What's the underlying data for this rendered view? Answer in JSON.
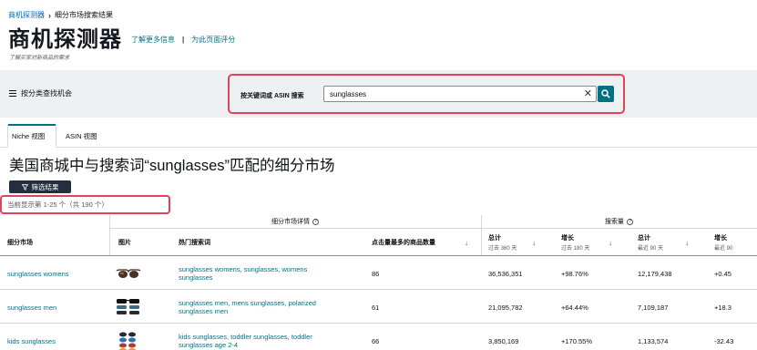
{
  "breadcrumb": {
    "root": "商机探测器",
    "current": "细分市场搜索结果"
  },
  "header": {
    "title": "商机探测器",
    "learn_more": "了解更多信息",
    "rate_page": "为此页面评分",
    "subtitle": "了解买家对新商品的需求"
  },
  "search_band": {
    "category_button": "按分类查找机会",
    "label": "按关键词或 ASIN 搜索",
    "value": "sunglasses",
    "placeholder": ""
  },
  "tabs": [
    {
      "label": "Niche 视图",
      "active": true
    },
    {
      "label": "ASIN 视图",
      "active": false
    }
  ],
  "results": {
    "heading": "美国商城中与搜索词“sunglasses”匹配的细分市场",
    "filter_button": "筛选结果",
    "count_text": "当前显示第 1-25 个（共 190 个）"
  },
  "table": {
    "group_details": "细分市场详情",
    "group_search_volume": "搜索量",
    "columns": {
      "niche": "细分市场",
      "image": "图片",
      "keywords": "热门搜索词",
      "clicked_products": "点击量最多的商品数量",
      "total_360": "总计",
      "total_360_sub": "过去 360 天",
      "growth_180": "增长",
      "growth_180_sub": "过去 180 天",
      "total_90": "总计",
      "total_90_sub": "最近 90 天",
      "growth_90": "增长",
      "growth_90_sub": "最近 90"
    },
    "rows": [
      {
        "niche": "sunglasses womens",
        "keywords": "sunglasses womens, sunglasses, womens sunglasses",
        "clicked": "86",
        "total360": "36,536,351",
        "growth180": "+98.76%",
        "total90": "12,179,438",
        "growth90": "+0.45"
      },
      {
        "niche": "sunglasses men",
        "keywords": "sunglasses men, mens sunglasses, polarized sunglasses men",
        "clicked": "61",
        "total360": "21,095,782",
        "growth180": "+64.44%",
        "total90": "7,109,187",
        "growth90": "+18.3"
      },
      {
        "niche": "kids sunglasses",
        "keywords": "kids sunglasses, toddler sunglasses, toddler sunglasses age 2-4",
        "clicked": "66",
        "total360": "3,850,169",
        "growth180": "+170.55%",
        "total90": "1,133,574",
        "growth90": "-32.43"
      }
    ]
  },
  "colors": {
    "accent": "#007185",
    "highlight_border": "#e0445c",
    "filter_bg": "#232f3e",
    "band_bg": "#eef1f1"
  },
  "icons": [
    "chevron-right-icon",
    "menu-icon",
    "clear-icon",
    "search-icon",
    "filter-icon",
    "help-icon",
    "sort-down-icon",
    "sunglasses-thumbnail"
  ]
}
